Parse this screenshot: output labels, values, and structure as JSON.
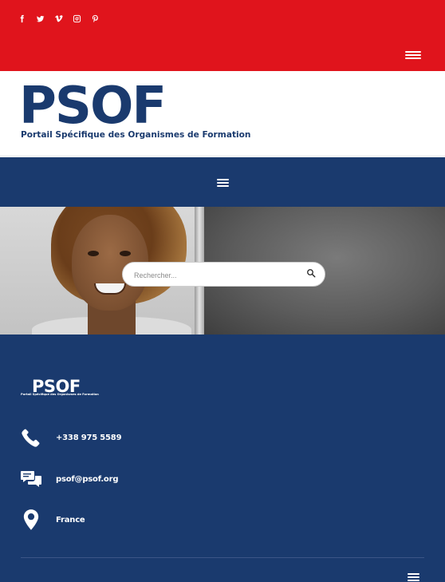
{
  "colors": {
    "topbar": "#e0141c",
    "brand_blue": "#1a3a6e",
    "white": "#ffffff"
  },
  "social": {
    "icons": [
      "facebook-icon",
      "twitter-icon",
      "vimeo-icon",
      "instagram-icon",
      "pinterest-icon"
    ]
  },
  "logo": {
    "wordmark": "PSOF",
    "tagline": "Portail Spécifique des Organismes de Formation"
  },
  "search": {
    "placeholder": "Rechercher..."
  },
  "footer": {
    "logo_wordmark": "PSOF",
    "logo_tagline": "Portail Spécifique des Organismes de Formation",
    "phone": "+338 975 5589",
    "email": "psof@psof.org",
    "location": "France"
  }
}
